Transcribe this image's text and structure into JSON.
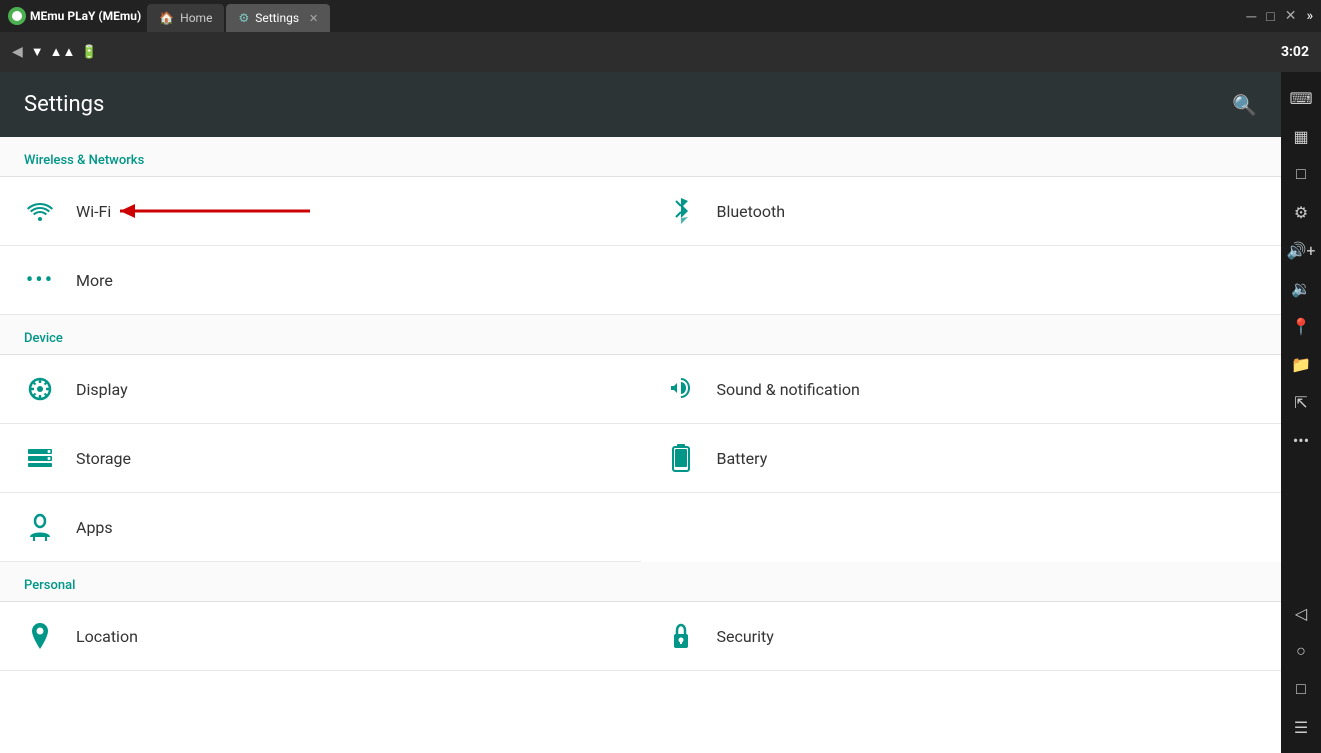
{
  "titlebar": {
    "app_name": "MEmu PLaY (MEmu)",
    "tabs": [
      {
        "label": "Home",
        "active": false,
        "has_close": false
      },
      {
        "label": "Settings",
        "active": true,
        "has_close": true
      }
    ],
    "controls": [
      "─",
      "□",
      "×"
    ],
    "sidebar_toggle": "»"
  },
  "addressbar": {
    "left_icon": "◀",
    "status_icons": [
      "wifi",
      "signal",
      "battery"
    ],
    "time": "3:02"
  },
  "settings": {
    "title": "Settings",
    "search_icon": "🔍",
    "sections": [
      {
        "id": "wireless",
        "header": "Wireless & networks",
        "items": [
          {
            "id": "wifi",
            "icon": "wifi",
            "label": "Wi-Fi",
            "has_arrow": true,
            "col": 1
          },
          {
            "id": "bluetooth",
            "icon": "bluetooth",
            "label": "Bluetooth",
            "col": 2
          },
          {
            "id": "more",
            "icon": "more",
            "label": "More",
            "col": 1
          }
        ]
      },
      {
        "id": "device",
        "header": "Device",
        "items": [
          {
            "id": "display",
            "icon": "display",
            "label": "Display",
            "col": 1
          },
          {
            "id": "sound",
            "icon": "sound",
            "label": "Sound & notification",
            "col": 2
          },
          {
            "id": "storage",
            "icon": "storage",
            "label": "Storage",
            "col": 1
          },
          {
            "id": "battery",
            "icon": "battery",
            "label": "Battery",
            "col": 2
          },
          {
            "id": "apps",
            "icon": "apps",
            "label": "Apps",
            "col": 1
          }
        ]
      },
      {
        "id": "personal",
        "header": "Personal",
        "items": [
          {
            "id": "location",
            "icon": "location",
            "label": "Location",
            "col": 1
          },
          {
            "id": "security",
            "icon": "security",
            "label": "Security",
            "col": 2
          }
        ]
      }
    ]
  },
  "right_sidebar": {
    "buttons": [
      "keyboard",
      "screenshot",
      "back",
      "settings",
      "vol-up",
      "vol-down",
      "location",
      "folder",
      "resize",
      "more",
      "nav-back",
      "home",
      "square",
      "menu"
    ]
  }
}
